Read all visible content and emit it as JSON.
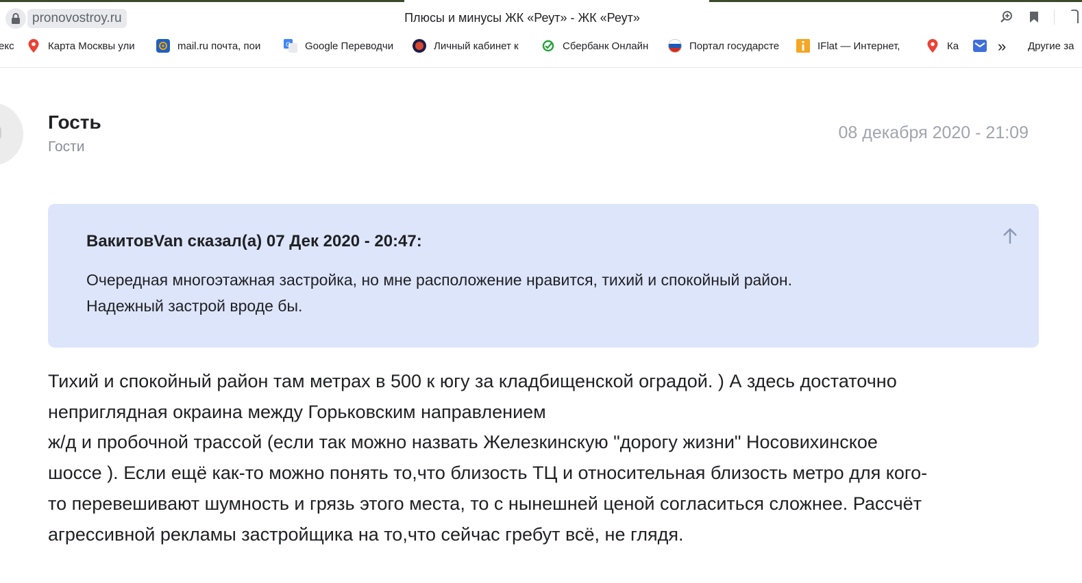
{
  "browser": {
    "url": "pronovostroy.ru",
    "tab_title": "Плюсы и минусы ЖК «Реут» - ЖК «Реут»",
    "bookmarks": [
      {
        "label": "екс",
        "icon": "partial"
      },
      {
        "label": "Карта Москвы ули",
        "icon": "map-pin-icon"
      },
      {
        "label": "mail.ru почта, пои",
        "icon": "mailru-icon"
      },
      {
        "label": "Google Переводчи",
        "icon": "google-translate-icon"
      },
      {
        "label": "Личный кабинет к",
        "icon": "mos-icon"
      },
      {
        "label": "Сбербанк Онлайн",
        "icon": "sberbank-icon"
      },
      {
        "label": "Портал государсте",
        "icon": "gosuslugi-icon"
      },
      {
        "label": "IFlat — Интернет, ",
        "icon": "iflat-icon"
      },
      {
        "label": "Ка",
        "icon": "map-pin-icon"
      },
      {
        "label": "",
        "icon": "mail-icon"
      }
    ],
    "more_bookmarks": "»",
    "other_bookmarks": "Другие за"
  },
  "post": {
    "author": "Гость",
    "group": "Гости",
    "date": "08 декабря 2020 - 21:09",
    "quote": {
      "header": "ВакитовVan сказал(а) 07 Дек 2020 - 20:47:",
      "lines": [
        "Очередная многоэтажная застройка, но мне расположение нравится, тихий и спокойный район.",
        "Надежный застрой вроде бы."
      ]
    },
    "body_lines": [
      "Тихий и спокойный район там метрах в 500 к югу за кладбищенской оградой. ) А здесь достаточно",
      "неприглядная окраина между Горьковским направлением",
      "ж/д и пробочной трассой (если так можно назвать Железкинскую \"дорогу жизни\" Носовихинское",
      "шоссе ). Если ещё как-то можно понять то,что близость ТЦ и относительная близость метро для кого-",
      "то перевешивают шумность и грязь этого места, то с нынешней ценой согласиться сложнее. Рассчёт",
      "агрессивной рекламы застройщика на то,что сейчас гребут всё, не глядя."
    ]
  },
  "colors": {
    "quote_bg": "#dde5fb",
    "muted_text": "#8a8f99",
    "date_text": "#a0a4ad"
  }
}
